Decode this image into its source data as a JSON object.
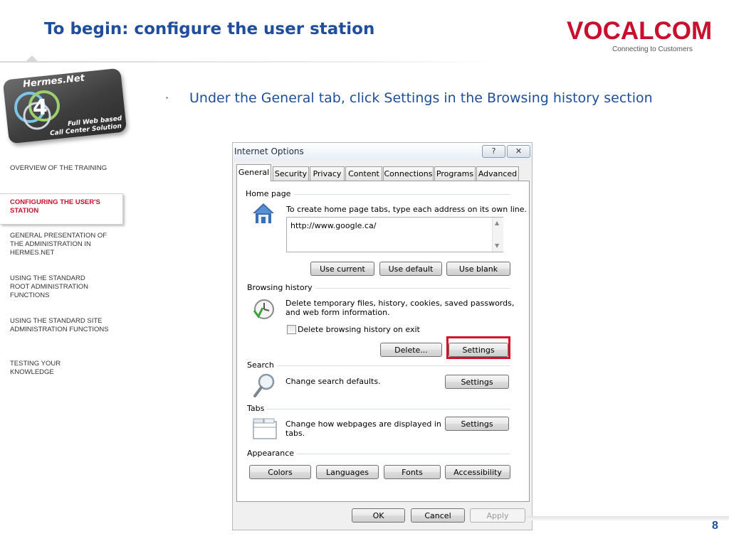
{
  "slide": {
    "title": "To begin: configure the user station",
    "brand": "VOCALCOM",
    "brand_tagline": "Connecting to Customers",
    "page_number": "8",
    "logo": {
      "title": "Hermes.Net",
      "version": "4",
      "line1": "Full Web based",
      "line2": "Call Center Solution"
    },
    "bullet": "Under the General tab, click Settings in the Browsing history section"
  },
  "sidebar": {
    "items": [
      {
        "label": "OVERVIEW OF THE TRAINING",
        "active": false
      },
      {
        "label": "CONFIGURING THE USER'S STATION",
        "active": true
      },
      {
        "label": "GENERAL PRESENTATION OF THE ADMINISTRATION IN HERMES.NET",
        "active": false
      },
      {
        "label": "USING THE STANDARD ROOT ADMINISTRATION FUNCTIONS",
        "active": false
      },
      {
        "label": "USING THE STANDARD SITE ADMINISTRATION FUNCTIONS",
        "active": false
      },
      {
        "label": "TESTING YOUR KNOWLEDGE",
        "active": false
      }
    ]
  },
  "dialog": {
    "title": "Internet Options",
    "help_glyph": "?",
    "close_glyph": "✕",
    "tabs": [
      "General",
      "Security",
      "Privacy",
      "Content",
      "Connections",
      "Programs",
      "Advanced"
    ],
    "active_tab": "General",
    "home_page": {
      "label": "Home page",
      "description": "To create home page tabs, type each address on its own line.",
      "url": "http://www.google.ca/",
      "buttons": [
        "Use current",
        "Use default",
        "Use blank"
      ]
    },
    "browsing_history": {
      "label": "Browsing history",
      "description_line1": "Delete temporary files, history, cookies, saved passwords,",
      "description_line2": "and web form information.",
      "checkbox_label": "Delete browsing history on exit",
      "checkbox_checked": false,
      "delete_button": "Delete...",
      "settings_button": "Settings"
    },
    "search": {
      "label": "Search",
      "description": "Change search defaults.",
      "settings_button": "Settings"
    },
    "tabs_section": {
      "label": "Tabs",
      "description_line1": "Change how webpages are displayed in",
      "description_line2": "tabs.",
      "settings_button": "Settings"
    },
    "appearance": {
      "label": "Appearance",
      "buttons": [
        "Colors",
        "Languages",
        "Fonts",
        "Accessibility"
      ]
    },
    "footer_buttons": {
      "ok": "OK",
      "cancel": "Cancel",
      "apply": "Apply"
    }
  },
  "colors": {
    "title_blue": "#1f4e9c",
    "brand_red": "#c8102e",
    "highlight_red": "#d4102a"
  }
}
